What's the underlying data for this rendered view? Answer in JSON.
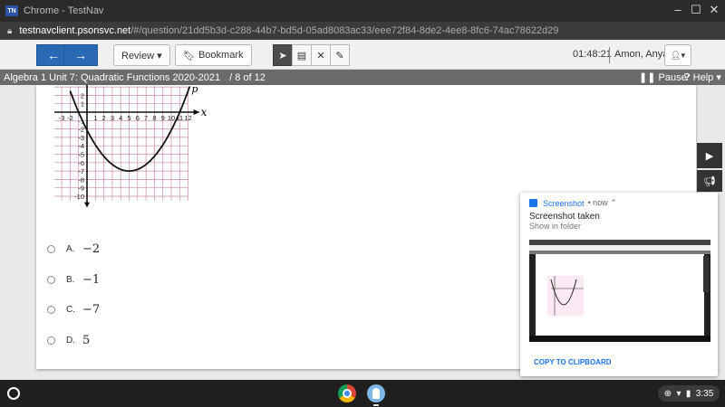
{
  "window": {
    "app_icon": "TN",
    "title": "Chrome - TestNav",
    "controls": [
      "minimize-icon",
      "maximize-icon",
      "close-icon"
    ]
  },
  "address": {
    "host": "testnavclient.psonsvc.net",
    "path": "/#/question/21dd5b3d-c288-44b7-bd5d-05ad8083ac33/eee72f84-8de2-4ee8-8fc6-74ac78622d29"
  },
  "toolbar": {
    "back_icon": "arrow-left-icon",
    "next_icon": "arrow-right-icon",
    "review_label": "Review ▾",
    "bookmark_label": "Bookmark",
    "tools": [
      "pointer-icon",
      "calculator-icon",
      "eliminator-icon",
      "notepad-icon"
    ],
    "timer": "01:48:21",
    "user_name": "Amon, Anya"
  },
  "test": {
    "title": "Algebra 1 Unit 7: Quadratic Functions 2020-2021",
    "page": "/   8 of 12",
    "pause_label": "Pause",
    "help_label": "Help ▾"
  },
  "graph": {
    "x_label": "x",
    "curve_label": "p",
    "x_ticks": [
      "-3",
      "-2",
      "1",
      "2",
      "3",
      "4",
      "5",
      "6",
      "7",
      "8",
      "9",
      "10",
      "11",
      "12"
    ],
    "y_ticks": [
      "2",
      "1",
      "-1",
      "-2",
      "-3",
      "-4",
      "-5",
      "-6",
      "-7",
      "-8",
      "-9",
      "-10"
    ],
    "vertex": [
      5,
      -7
    ],
    "x_intercepts": [
      -1,
      11
    ]
  },
  "choices": [
    {
      "letter": "A.",
      "value": "−2"
    },
    {
      "letter": "B.",
      "value": "−1"
    },
    {
      "letter": "C.",
      "value": "−7"
    },
    {
      "letter": "D.",
      "value": "5"
    }
  ],
  "side_tabs": [
    "play-icon",
    "megaphone-icon"
  ],
  "notification": {
    "app": "Screenshot",
    "time": "• now ⌃",
    "title": "Screenshot taken",
    "subtitle": "Show in folder",
    "action": "COPY TO CLIPBOARD"
  },
  "shelf": {
    "clock": "3:35",
    "tray_icons": [
      "add-icon",
      "wifi-icon",
      "battery-icon"
    ]
  }
}
